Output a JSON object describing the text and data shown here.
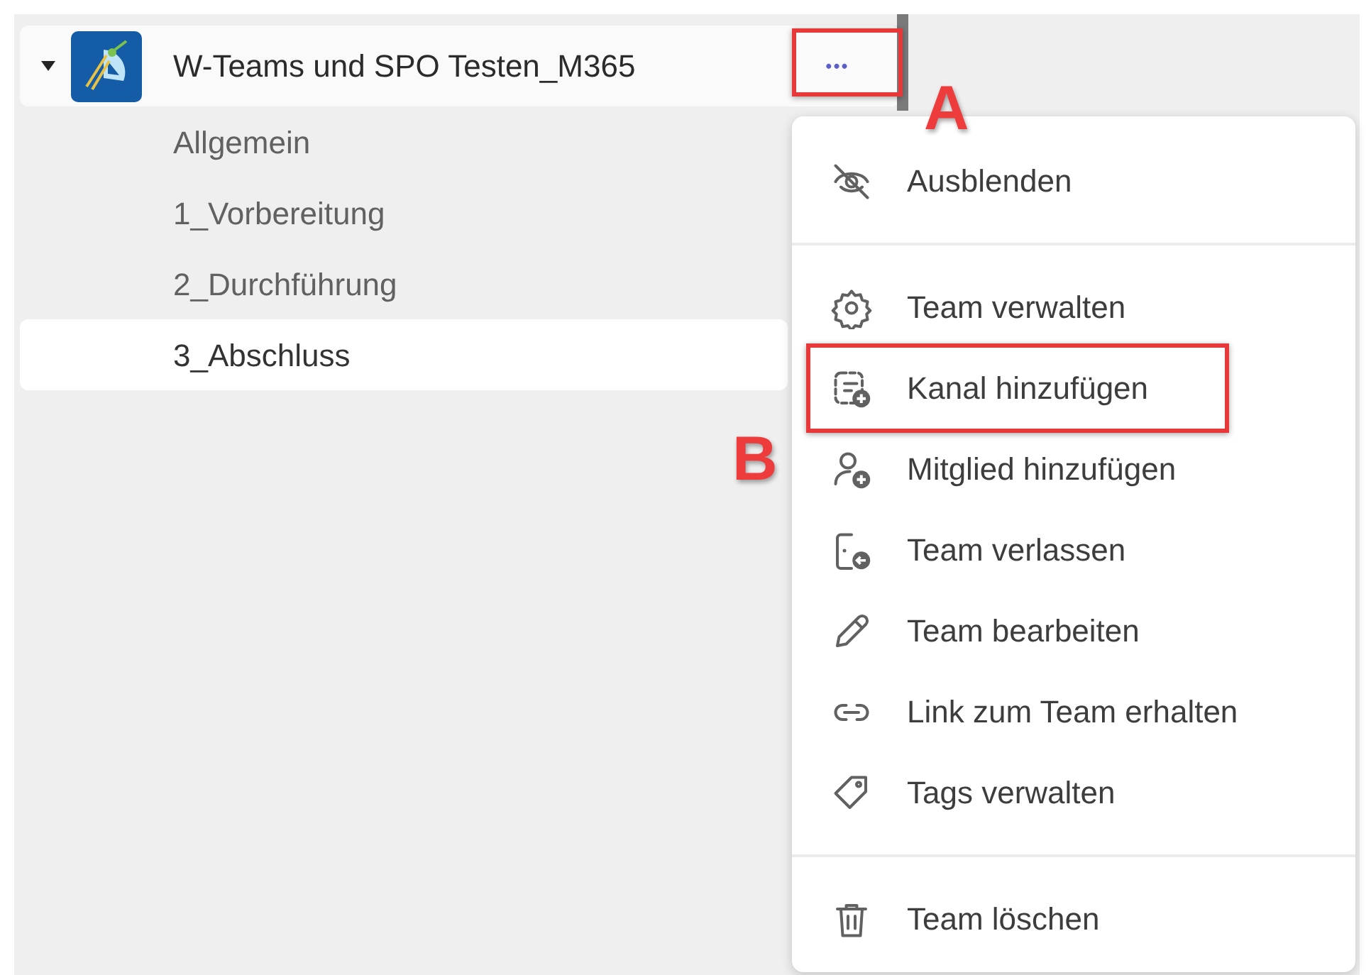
{
  "team": {
    "name": "W-Teams und SPO Testen_M365",
    "expanded": true,
    "more_button": {
      "label": "•••",
      "annotated": true,
      "annotation": "A"
    }
  },
  "channels": [
    {
      "name": "Allgemein",
      "selected": false
    },
    {
      "name": "1_Vorbereitung",
      "selected": false
    },
    {
      "name": "2_Durchführung",
      "selected": false
    },
    {
      "name": "3_Abschluss",
      "selected": true
    }
  ],
  "menu": {
    "sections": [
      [
        {
          "label": "Ausblenden",
          "annotated": false
        }
      ],
      [
        {
          "label": "Team verwalten",
          "annotated": false
        },
        {
          "label": "Kanal hinzufügen",
          "annotated": true,
          "annotation": "B"
        },
        {
          "label": "Mitglied hinzufügen",
          "annotated": false
        },
        {
          "label": "Team verlassen",
          "annotated": false
        },
        {
          "label": "Team bearbeiten",
          "annotated": false
        },
        {
          "label": "Link zum Team erhalten",
          "annotated": false
        },
        {
          "label": "Tags verwalten",
          "annotated": false
        }
      ],
      [
        {
          "label": "Team löschen",
          "annotated": false
        }
      ]
    ]
  }
}
